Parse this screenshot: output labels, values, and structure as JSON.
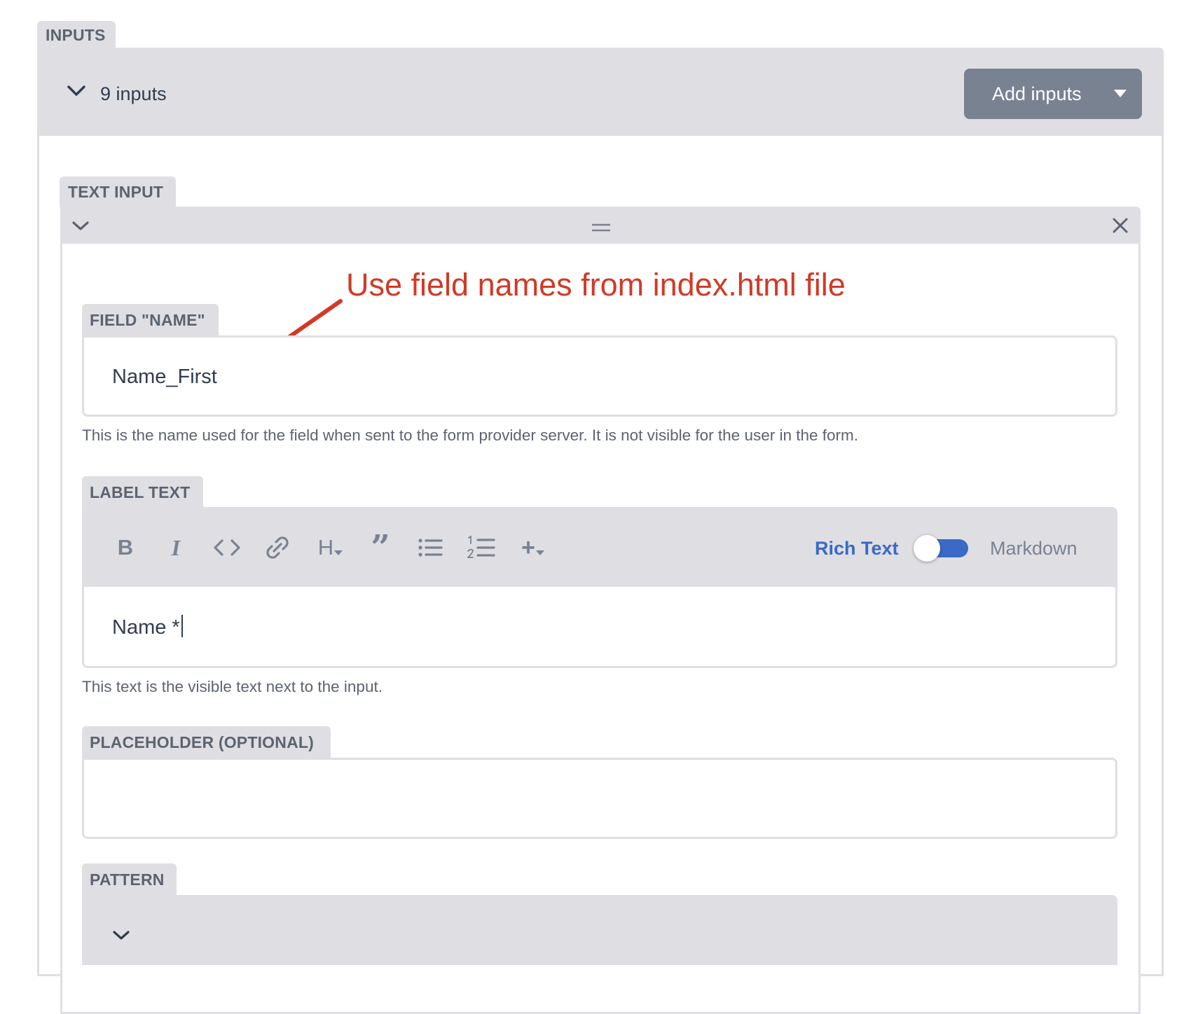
{
  "inputs_section": {
    "tab_label": "INPUTS",
    "count_label": "9 inputs",
    "add_button_label": "Add inputs"
  },
  "text_input": {
    "tab_label": "TEXT INPUT"
  },
  "annotation": {
    "text": "Use field names from index.html file",
    "color": "#d13a27"
  },
  "field_name": {
    "label": "FIELD \"NAME\"",
    "value": "Name_First",
    "hint": "This is the name used for the field when sent to the form provider server. It is not visible for the user in the form."
  },
  "label_text": {
    "label": "LABEL TEXT",
    "value": "Name *",
    "hint": "This text is the visible text next to the input.",
    "toolbar": {
      "bold": "B",
      "italic": "I",
      "heading": "H",
      "quote": "”",
      "plus": "+"
    },
    "mode_active": "Rich Text",
    "mode_inactive": "Markdown",
    "toggle_on": true
  },
  "placeholder": {
    "label": "PLACEHOLDER (OPTIONAL)",
    "value": ""
  },
  "pattern": {
    "label": "PATTERN"
  },
  "colors": {
    "panel": "#dfdfe3",
    "button": "#798291",
    "accent": "#3a69c7",
    "text": "#313d4f"
  }
}
